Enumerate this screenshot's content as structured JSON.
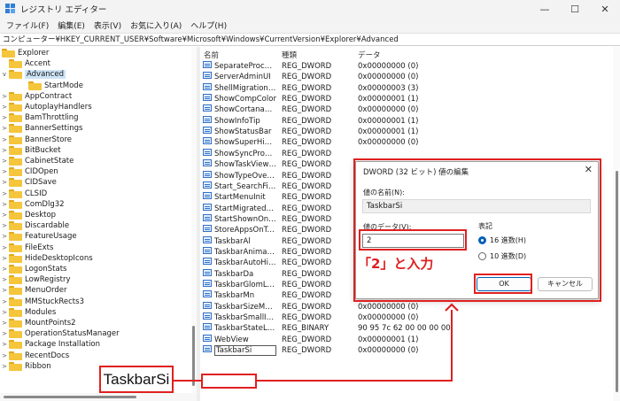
{
  "window": {
    "title": "レジストリ エディター",
    "minimize": "—",
    "maximize": "☐",
    "close": "✕"
  },
  "menu": [
    "ファイル(F)",
    "編集(E)",
    "表示(V)",
    "お気に入り(A)",
    "ヘルプ(H)"
  ],
  "address": "コンピューター¥HKEY_CURRENT_USER¥Software¥Microsoft¥Windows¥CurrentVersion¥Explorer¥Advanced",
  "tree": {
    "root": "Explorer",
    "items": [
      {
        "label": "Accent",
        "expander": ""
      },
      {
        "label": "Advanced",
        "expander": "v",
        "selected": true
      },
      {
        "label": "StartMode",
        "expander": "",
        "child": true
      },
      {
        "label": "AppContract",
        "expander": ">"
      },
      {
        "label": "AutoplayHandlers",
        "expander": ">"
      },
      {
        "label": "BamThrottling",
        "expander": ">"
      },
      {
        "label": "BannerSettings",
        "expander": ">"
      },
      {
        "label": "BannerStore",
        "expander": ">"
      },
      {
        "label": "BitBucket",
        "expander": ">"
      },
      {
        "label": "CabinetState",
        "expander": ">"
      },
      {
        "label": "CIDOpen",
        "expander": ">"
      },
      {
        "label": "CIDSave",
        "expander": ">"
      },
      {
        "label": "CLSID",
        "expander": ">"
      },
      {
        "label": "ComDlg32",
        "expander": ">"
      },
      {
        "label": "Desktop",
        "expander": ">"
      },
      {
        "label": "Discardable",
        "expander": ">"
      },
      {
        "label": "FeatureUsage",
        "expander": ">"
      },
      {
        "label": "FileExts",
        "expander": ">"
      },
      {
        "label": "HideDesktopIcons",
        "expander": ">"
      },
      {
        "label": "LogonStats",
        "expander": ">"
      },
      {
        "label": "LowRegistry",
        "expander": ">"
      },
      {
        "label": "MenuOrder",
        "expander": ">"
      },
      {
        "label": "MMStuckRects3",
        "expander": ">"
      },
      {
        "label": "Modules",
        "expander": ">"
      },
      {
        "label": "MountPoints2",
        "expander": ">"
      },
      {
        "label": "OperationStatusManager",
        "expander": ">"
      },
      {
        "label": "Package Installation",
        "expander": ">"
      },
      {
        "label": "RecentDocs",
        "expander": ">"
      },
      {
        "label": "Ribbon",
        "expander": ">"
      }
    ]
  },
  "values": {
    "headers": {
      "name": "名前",
      "type": "種類",
      "data": "データ"
    },
    "rows": [
      {
        "name": "SeparateProcess",
        "type": "REG_DWORD",
        "data": "0x00000000 (0)"
      },
      {
        "name": "ServerAdminUI",
        "type": "REG_DWORD",
        "data": "0x00000000 (0)"
      },
      {
        "name": "ShellMigrationL...",
        "type": "REG_DWORD",
        "data": "0x00000003 (3)"
      },
      {
        "name": "ShowCompColor",
        "type": "REG_DWORD",
        "data": "0x00000001 (1)"
      },
      {
        "name": "ShowCortanaBu...",
        "type": "REG_DWORD",
        "data": "0x00000000 (0)"
      },
      {
        "name": "ShowInfoTip",
        "type": "REG_DWORD",
        "data": "0x00000001 (1)"
      },
      {
        "name": "ShowStatusBar",
        "type": "REG_DWORD",
        "data": "0x00000001 (1)"
      },
      {
        "name": "ShowSuperHidd...",
        "type": "REG_DWORD",
        "data": "0x00000000 (0)"
      },
      {
        "name": "ShowSyncProvi...",
        "type": "REG_DWORD",
        "data": ""
      },
      {
        "name": "ShowTaskViewB...",
        "type": "REG_DWORD",
        "data": ""
      },
      {
        "name": "ShowTypeOverlay",
        "type": "REG_DWORD",
        "data": ""
      },
      {
        "name": "Start_SearchFiles",
        "type": "REG_DWORD",
        "data": ""
      },
      {
        "name": "StartMenuInit",
        "type": "REG_DWORD",
        "data": ""
      },
      {
        "name": "StartMigratedBr...",
        "type": "REG_DWORD",
        "data": ""
      },
      {
        "name": "StartShownOnU...",
        "type": "REG_DWORD",
        "data": ""
      },
      {
        "name": "StoreAppsOnTas...",
        "type": "REG_DWORD",
        "data": ""
      },
      {
        "name": "TaskbarAl",
        "type": "REG_DWORD",
        "data": ""
      },
      {
        "name": "TaskbarAnimatio...",
        "type": "REG_DWORD",
        "data": ""
      },
      {
        "name": "TaskbarAutoHid...",
        "type": "REG_DWORD",
        "data": ""
      },
      {
        "name": "TaskbarDa",
        "type": "REG_DWORD",
        "data": ""
      },
      {
        "name": "TaskbarGlomLevel",
        "type": "REG_DWORD",
        "data": "0x00000000 (0)"
      },
      {
        "name": "TaskbarMn",
        "type": "REG_DWORD",
        "data": "0x00000000 (0)"
      },
      {
        "name": "TaskbarSizeMove",
        "type": "REG_DWORD",
        "data": "0x00000000 (0)"
      },
      {
        "name": "TaskbarSmallIcons",
        "type": "REG_DWORD",
        "data": "0x00000000 (0)"
      },
      {
        "name": "TaskbarStateLast...",
        "type": "REG_BINARY",
        "data": "90 95 7c 62 00 00 00 00"
      },
      {
        "name": "WebView",
        "type": "REG_DWORD",
        "data": "0x00000001 (1)"
      },
      {
        "name": "TaskbarSi",
        "type": "REG_DWORD",
        "data": "0x00000000 (0)",
        "editing": true
      }
    ]
  },
  "dialog": {
    "title": "DWORD (32 ビット) 値の編集",
    "close": "✕",
    "name_label": "値の名前(N):",
    "name_value": "TaskbarSi",
    "data_label": "値のデータ(V):",
    "data_value": "2",
    "radix_label": "表記",
    "radix_hex": "16 進数(H)",
    "radix_dec": "10 進数(D)",
    "selected_radix": "hex",
    "ok": "OK",
    "cancel": "キャンセル"
  },
  "annotations": {
    "callout": "TaskbarSi",
    "instruction": "「2」と入力",
    "accent_color": "#e02020"
  }
}
